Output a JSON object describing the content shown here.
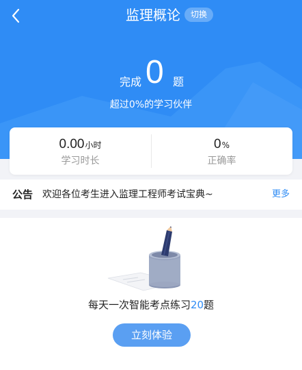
{
  "header": {
    "title": "监理概论",
    "switch_label": "切换",
    "done_prefix": "完成",
    "done_count": "0",
    "done_suffix": "题",
    "surpass_text": "超过0%的学习伙伴"
  },
  "stats": [
    {
      "value": "0.00",
      "unit": "小时",
      "label": "学习时长"
    },
    {
      "value": "0",
      "unit": "%",
      "label": "正确率"
    }
  ],
  "notice": {
    "tag": "公告",
    "text": "欢迎各位考生进入监理工程师考试宝典~",
    "more": "更多"
  },
  "practice": {
    "text_prefix": "每天一次智能考点练习",
    "count": "20",
    "text_suffix": "题",
    "button_label": "立刻体验"
  },
  "colors": {
    "brand_blue": "#2f8cf5",
    "button_blue": "#5a9ff2"
  },
  "icons": {
    "back": "chevron-left-icon",
    "illustration": "pencil-cup-illustration"
  }
}
